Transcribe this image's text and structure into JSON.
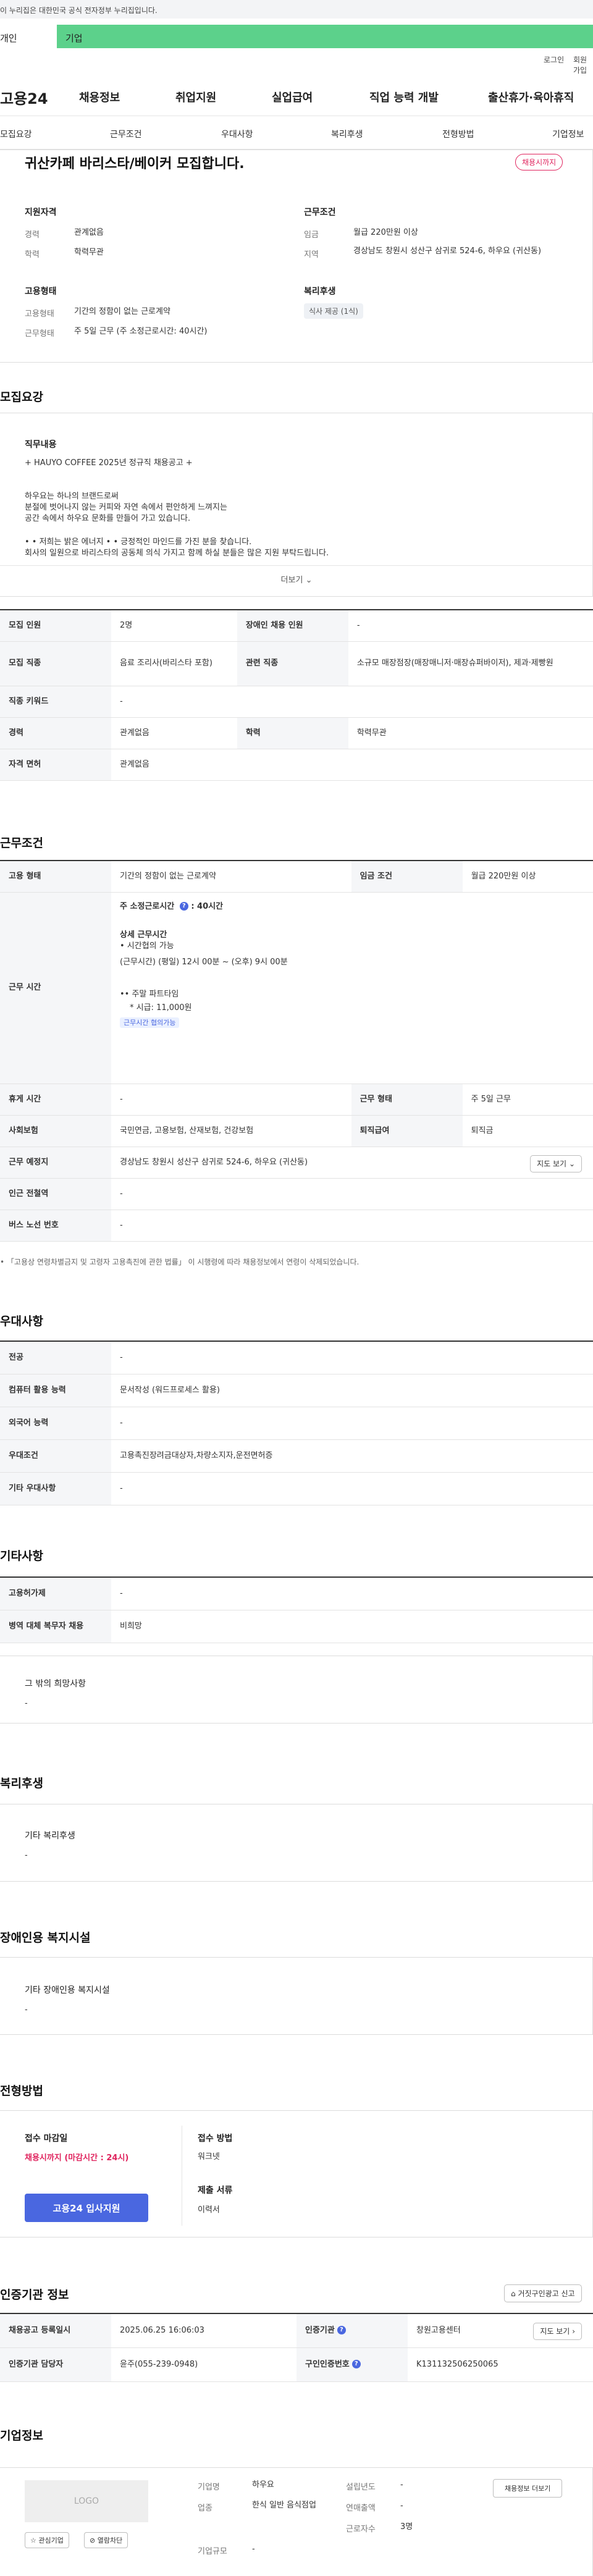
{
  "gov_banner": "이 누리집은 대한민국 공식 전자정부 누리집입니다.",
  "tabs": {
    "individual": "개인",
    "company": "기업"
  },
  "util": {
    "login": "로그인",
    "join": "회원가입"
  },
  "logo": "고용24",
  "gnb": [
    "채용정보",
    "취업지원",
    "실업급여",
    "직업 능력 개발",
    "출산휴가·육아휴직"
  ],
  "subnav": [
    "모집요강",
    "근무조건",
    "우대사항",
    "복리후생",
    "전형방법",
    "기업정보"
  ],
  "summary": {
    "title": "귀산카페 바리스타/베이커 모집합니다.",
    "status_badge": "채용시까지",
    "qual_h": "지원자격",
    "qual": [
      {
        "label": "경력",
        "value": "관계없음"
      },
      {
        "label": "학력",
        "value": "학력무관"
      }
    ],
    "work_h": "근무조건",
    "work": [
      {
        "label": "임금",
        "value": "월급 220만원 이상"
      },
      {
        "label": "지역",
        "value": "경상남도 창원시 성산구 삼귀로 524-6, 하우요 (귀산동)"
      }
    ],
    "emp_h": "고용형태",
    "emp": [
      {
        "label": "고용형태",
        "value": "기간의 정함이 없는 근로계약"
      },
      {
        "label": "근무형태",
        "value": "주 5일 근무 (주 소정근로시간: 40시간)"
      }
    ],
    "welfare_h": "복리후생",
    "welfare_chip": "식사 제공 (1식)"
  },
  "recruit": {
    "title": "모집요강",
    "sub": "직무내용",
    "body": [
      "+ HAUYO COFFEE 2025년 정규직 채용공고 +",
      "",
      "하우요는 하나의 브랜드로써",
      "분절에 벗어나지 않는 커피와 자연 속에서 편안하게 느껴지는",
      "공간 속에서 하우요 문화를 만들어 가고 있습니다.",
      "",
      "• • 저희는 밝은 에너지 • • 긍정적인 마인드를 가진 분을 찾습니다.",
      "회사의 일원으로 바리스타의 공동체 의식 가지고 함께 하실 분들은 많은 지원 부탁드립니다."
    ],
    "more": "더보기",
    "rows": [
      [
        {
          "k": "모집 인원",
          "v": "2명"
        },
        {
          "k": "장애인 채용 인원",
          "v": "-"
        }
      ],
      [
        {
          "k": "모집 직종",
          "v": "음료 조리사(바리스타 포함)"
        },
        {
          "k": "관련 직종",
          "v": "소규모 매장점장(매장매니저·매장슈퍼바이저), 제과·제빵원"
        }
      ],
      [
        {
          "k": "직종 키워드",
          "v": "-"
        }
      ],
      [
        {
          "k": "경력",
          "v": "관계없음"
        },
        {
          "k": "학력",
          "v": "학력무관"
        }
      ],
      [
        {
          "k": "자격 면허",
          "v": "관계없음"
        }
      ]
    ]
  },
  "conditions": {
    "title": "근무조건",
    "emp_type_k": "고용 형태",
    "emp_type_v": "기간의 정함이 없는 근로계약",
    "wage_k": "임금 조건",
    "wage_v": "월급 220만원 이상",
    "hours_k": "근무 시간",
    "hours_weekly": "주 소정근로시간",
    "hours_weekly_val": "40시간",
    "hours_detail_h": "상세 근무시간",
    "hours_detail": [
      "• 시간협의 가능",
      "(근무시간) (평일) 12시 00분 ~ (오후) 9시 00분"
    ],
    "parttime": "•• 주말 파트타임",
    "parttime_wage": "* 시급: 11,000원",
    "consult_chip": "근무시간 협의가능",
    "break_k": "휴게 시간",
    "break_v": "-",
    "shift_k": "근무 형태",
    "shift_v": "주 5일 근무",
    "insurance_k": "사회보험",
    "insurance_v": "국민연금, 고용보험, 산재보험, 건강보험",
    "severance_k": "퇴직급여",
    "severance_v": "퇴직금",
    "location_k": "근무 예정지",
    "location_v": "경상남도 창원시 성산구 삼귀로 524-6, 하우요 (귀산동)",
    "map_btn": "지도 보기",
    "subway_k": "인근 전철역",
    "subway_v": "-",
    "bus_k": "버스 노선 번호",
    "bus_v": "-",
    "note": "「고용상 연령차별금지 및 고령자 고용촉진에 관한 법률」 이 시행령에 따라 채용정보에서 연령이 삭제되었습니다."
  },
  "preference": {
    "title": "우대사항",
    "rows": [
      {
        "k": "전공",
        "v": "-"
      },
      {
        "k": "컴퓨터 활용 능력",
        "v": "문서작성 (워드프로세스 활용)"
      },
      {
        "k": "외국어 능력",
        "v": "-"
      },
      {
        "k": "우대조건",
        "v": "고용촉진장려금대상자,차량소지자,운전면허증"
      },
      {
        "k": "기타 우대사항",
        "v": "-"
      }
    ]
  },
  "etc": {
    "title": "기타사항",
    "rows": [
      {
        "k": "고용허가제",
        "v": "-"
      },
      {
        "k": "병역 대체 복무자 채용",
        "v": "비희망"
      }
    ],
    "hope_h": "그 밖의 희망사항",
    "hope_v": "-"
  },
  "welfare": {
    "title": "복리후생",
    "sub": "기타 복리후생",
    "v": "-"
  },
  "disabled": {
    "title": "장애인용 복지시설",
    "sub": "기타 장애인용 복지시설",
    "v": "-"
  },
  "process": {
    "title": "전형방법",
    "deadline_h": "접수 마감일",
    "deadline_v": "채용시까지 (마감시간 : 24시)",
    "apply_btn": "고용24 입사지원",
    "method_h": "접수 방법",
    "method_v": "워크넷",
    "docs_h": "제출 서류",
    "docs_v": "이력서"
  },
  "agency": {
    "title": "인증기관 정보",
    "report_btn": "거짓구인광고 신고",
    "regdate_k": "채용공고 등록일시",
    "regdate_v": "2025.06.25 16:06:03",
    "agency_k": "인증기관",
    "agency_v": "창원고용센터",
    "map_btn": "지도 보기",
    "contact_k": "인증기관 담당자",
    "contact_v": "윤주(055-239-0948)",
    "cert_k": "구인인증번호",
    "cert_v": "K131132506250065"
  },
  "company": {
    "title": "기업정보",
    "logo": "LOGO",
    "fav_btn": "관심기업",
    "block_btn": "열람차단",
    "rows_left": [
      {
        "k": "기업명",
        "v": "하우요"
      },
      {
        "k": "업종",
        "v": "한식 일반 음식점업"
      },
      {
        "k": "기업규모",
        "v": "-"
      }
    ],
    "rows_right": [
      {
        "k": "설립년도",
        "v": "-"
      },
      {
        "k": "연매출액",
        "v": "-"
      },
      {
        "k": "근로자수",
        "v": "3명"
      }
    ],
    "more_btn": "채용정보 더보기"
  },
  "colors": {
    "brand_green": "#5cd18b",
    "accent_blue": "#4a67e0",
    "accent_red": "#e0245e"
  }
}
